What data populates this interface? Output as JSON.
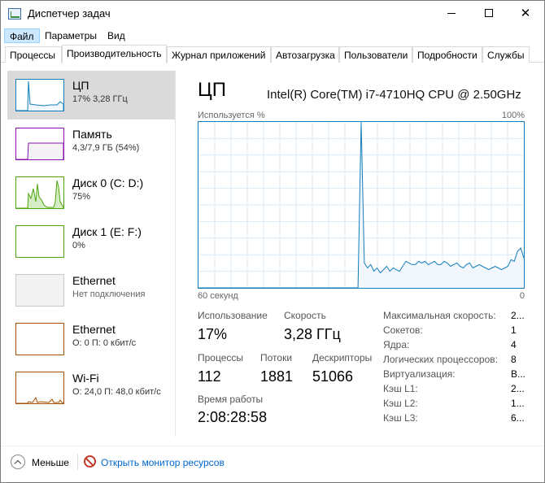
{
  "window": {
    "title": "Диспетчер задач"
  },
  "menu": [
    "Файл",
    "Параметры",
    "Вид"
  ],
  "tabs": [
    "Процессы",
    "Производительность",
    "Журнал приложений",
    "Автозагрузка",
    "Пользователи",
    "Подробности",
    "Службы"
  ],
  "selected_tab": "Производительность",
  "resources": [
    {
      "name": "ЦП",
      "sub": "17% 3,28 ГГц",
      "color": "#117dbb",
      "selected": true
    },
    {
      "name": "Память",
      "sub": "4,3/7,9 ГБ (54%)",
      "color": "#8b12ae"
    },
    {
      "name": "Диск 0 (C: D:)",
      "sub": "75%",
      "color": "#4da60c"
    },
    {
      "name": "Диск 1 (E: F:)",
      "sub": "0%",
      "color": "#4da60c"
    },
    {
      "name": "Ethernet",
      "sub": "Нет подключения",
      "color": "#c0c0c0"
    },
    {
      "name": "Ethernet",
      "sub": "О: 0 П: 0 кбит/с",
      "color": "#a74f01"
    },
    {
      "name": "Wi-Fi",
      "sub": "О: 24,0 П: 48,0 кбит/с",
      "color": "#a74f01"
    }
  ],
  "detail": {
    "title": "ЦП",
    "model": "Intel(R) Core(TM) i7-4710HQ CPU @ 2.50GHz",
    "graph_label": "Используется %",
    "graph_max": "100%",
    "graph_time": "60 секунд",
    "graph_min": "0",
    "graph_color": "#117dbb",
    "utilization_history": [
      0,
      0,
      0,
      0,
      0,
      0,
      0,
      0,
      0,
      0,
      0,
      0,
      0,
      0,
      0,
      0,
      0,
      0,
      0,
      0,
      0,
      0,
      0,
      0,
      0,
      0,
      0,
      0,
      0,
      0,
      0,
      0,
      0,
      0,
      0,
      0,
      0,
      0,
      0,
      0,
      0,
      0,
      0,
      0,
      0,
      0,
      0,
      0,
      0,
      0,
      0,
      100,
      15,
      12,
      14,
      10,
      12,
      9,
      11,
      13,
      10,
      12,
      11,
      10,
      13,
      16,
      15,
      14,
      14,
      16,
      15,
      16,
      14,
      15,
      16,
      14,
      14,
      16,
      15,
      13,
      14,
      15,
      13,
      12,
      14,
      15,
      12,
      13,
      14,
      13,
      12,
      11,
      12,
      13,
      12,
      11,
      12,
      13,
      17,
      16,
      22,
      24,
      18
    ]
  },
  "stats": {
    "usage_label": "Использование",
    "usage_value": "17%",
    "speed_label": "Скорость",
    "speed_value": "3,28 ГГц",
    "proc_label": "Процессы",
    "proc_value": "112",
    "threads_label": "Потоки",
    "threads_value": "1881",
    "handles_label": "Дескрипторы",
    "handles_value": "51066",
    "uptime_label": "Время работы",
    "uptime_value": "2:08:28:58"
  },
  "specs": [
    {
      "label": "Максимальная скорость:",
      "value": "2..."
    },
    {
      "label": "Сокетов:",
      "value": "1"
    },
    {
      "label": "Ядра:",
      "value": "4"
    },
    {
      "label": "Логических процессоров:",
      "value": "8"
    },
    {
      "label": "Виртуализация:",
      "value": "В..."
    },
    {
      "label": "Кэш L1:",
      "value": "2..."
    },
    {
      "label": "Кэш L2:",
      "value": "1..."
    },
    {
      "label": "Кэш L3:",
      "value": "6..."
    }
  ],
  "footer": {
    "less": "Меньше",
    "monitor": "Открыть монитор ресурсов"
  }
}
